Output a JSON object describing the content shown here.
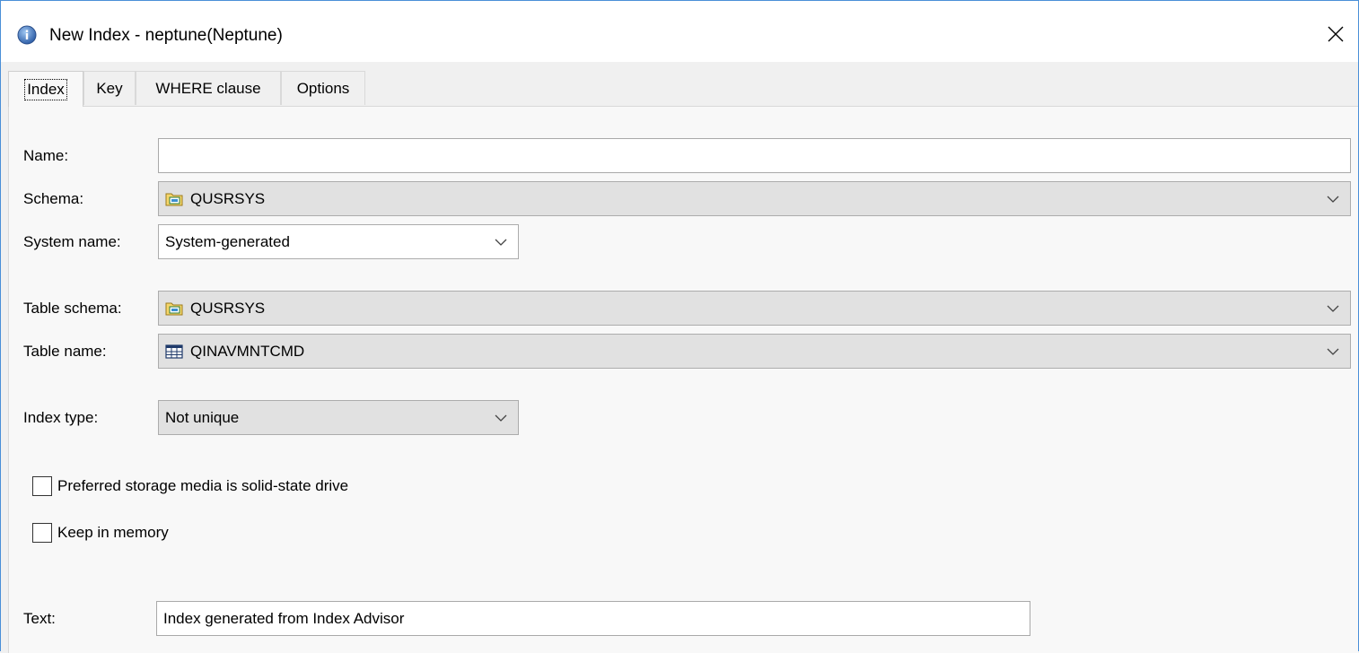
{
  "window": {
    "title": "New Index - neptune(Neptune)",
    "app_icon": "info-globe-icon",
    "close_icon": "close-icon"
  },
  "tabs": [
    {
      "label": "Index",
      "active": true
    },
    {
      "label": "Key",
      "active": false
    },
    {
      "label": "WHERE clause",
      "active": false
    },
    {
      "label": "Options",
      "active": false
    }
  ],
  "form": {
    "name": {
      "label": "Name:",
      "value": ""
    },
    "schema": {
      "label": "Schema:",
      "value": "QUSRSYS",
      "icon": "schema-folder-icon"
    },
    "system_name": {
      "label": "System name:",
      "value": "System-generated"
    },
    "table_schema": {
      "label": "Table schema:",
      "value": "QUSRSYS",
      "icon": "schema-folder-icon"
    },
    "table_name": {
      "label": "Table name:",
      "value": "QINAVMNTCMD",
      "icon": "table-grid-icon"
    },
    "index_type": {
      "label": "Index type:",
      "value": "Not unique"
    },
    "ssd_checkbox": {
      "label": "Preferred storage media is solid-state drive",
      "checked": false
    },
    "keep_memory_checkbox": {
      "label": "Keep in memory",
      "checked": false
    },
    "text": {
      "label": "Text:",
      "value": "Index generated from Index Advisor"
    }
  },
  "colors": {
    "window_border": "#4a8fd8",
    "panel_bg": "#f8f8f8",
    "combo_gray": "#e1e1e1"
  }
}
